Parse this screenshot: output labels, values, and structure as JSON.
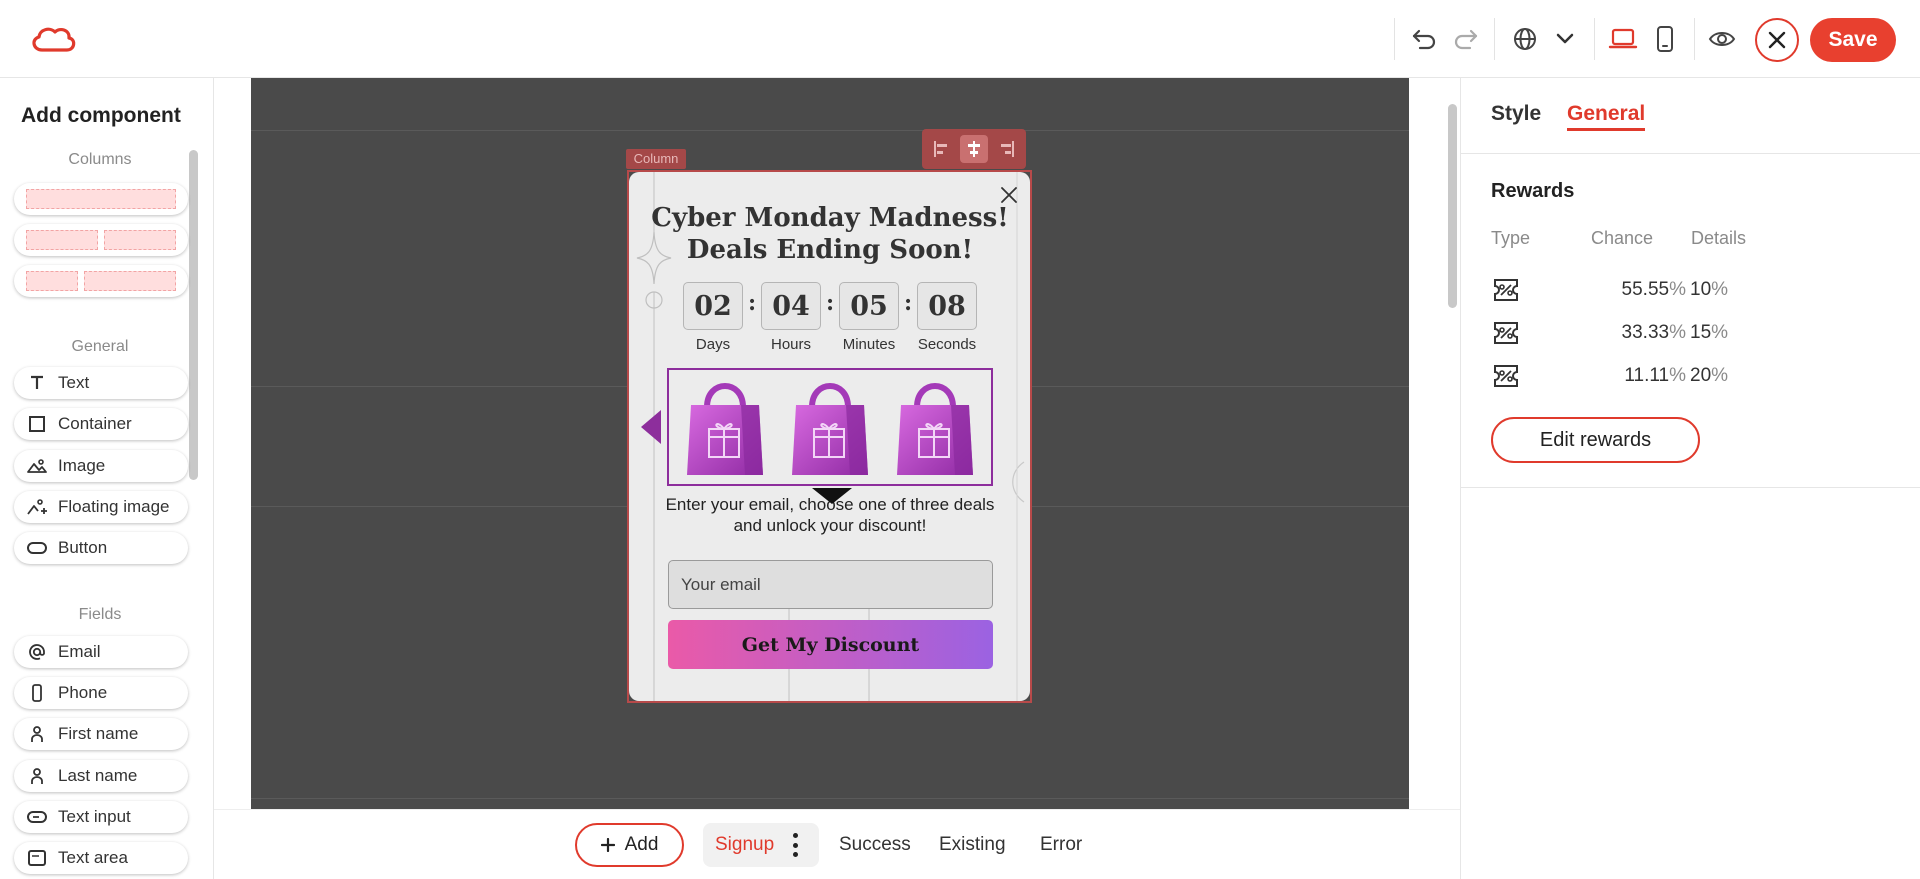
{
  "toolbar": {
    "save_label": "Save",
    "icons": [
      "logo-icon",
      "undo-icon",
      "redo-icon",
      "globe-icon",
      "chevron-down-icon",
      "desktop-icon",
      "mobile-icon",
      "eye-icon",
      "close-icon"
    ]
  },
  "left_panel": {
    "title": "Add component",
    "sections": {
      "columns": "Columns",
      "general": "General",
      "fields": "Fields"
    },
    "general_items": [
      {
        "label": "Text",
        "icon": "text-icon"
      },
      {
        "label": "Container",
        "icon": "square-icon"
      },
      {
        "label": "Image",
        "icon": "image-icon"
      },
      {
        "label": "Floating image",
        "icon": "floating-image-icon"
      },
      {
        "label": "Button",
        "icon": "button-icon"
      }
    ],
    "field_items": [
      {
        "label": "Email",
        "icon": "at-icon"
      },
      {
        "label": "Phone",
        "icon": "phone-icon"
      },
      {
        "label": "First name",
        "icon": "person-icon"
      },
      {
        "label": "Last name",
        "icon": "person-icon"
      },
      {
        "label": "Text input",
        "icon": "text-input-icon"
      },
      {
        "label": "Text area",
        "icon": "text-area-icon"
      }
    ]
  },
  "canvas": {
    "column_label": "Column",
    "popup": {
      "title": "Cyber Monday Madness! Deals Ending Soon!",
      "countdown": [
        {
          "value": "02",
          "label": "Days"
        },
        {
          "value": "04",
          "label": "Hours"
        },
        {
          "value": "05",
          "label": "Minutes"
        },
        {
          "value": "08",
          "label": "Seconds"
        }
      ],
      "description": "Enter your email, choose one of three deals and unlock your discount!",
      "email_placeholder": "Your email",
      "cta_label": "Get My Discount",
      "colors": {
        "bag": "#b23fc0",
        "cta_start": "#ea5aa8",
        "cta_end": "#9b62e2"
      }
    }
  },
  "bottom_tabs": {
    "add_label": "Add",
    "active": "Signup",
    "tabs": [
      "Success",
      "Existing",
      "Error"
    ]
  },
  "right_panel": {
    "tabs": [
      "Style",
      "General"
    ],
    "active_tab": "General",
    "heading": "Rewards",
    "columns": [
      "Type",
      "Chance",
      "Details"
    ],
    "rewards": [
      {
        "type_icon": "discount-icon",
        "chance": "55.55",
        "details": "10"
      },
      {
        "type_icon": "discount-icon",
        "chance": "33.33",
        "details": "15"
      },
      {
        "type_icon": "discount-icon",
        "chance": "11.11",
        "details": "20"
      }
    ],
    "percent_unit": "%",
    "edit_label": "Edit rewards"
  },
  "accent_color": "#e03a2c"
}
